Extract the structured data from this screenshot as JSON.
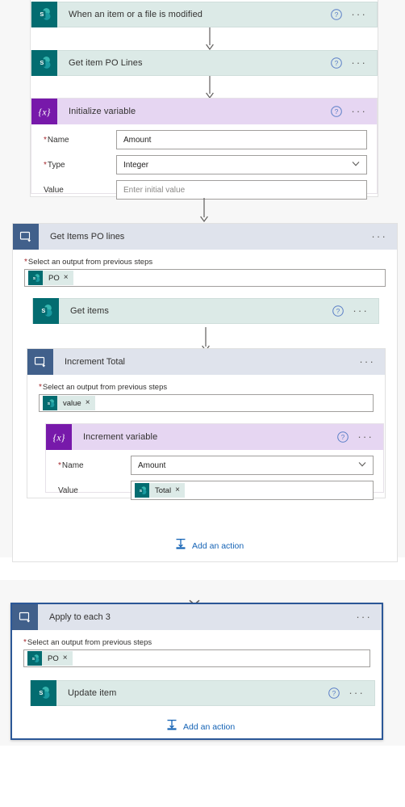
{
  "app": {
    "name": "Power Automate flow designer",
    "connectors": {
      "sharepoint_teal": "#036c70",
      "variable_purple": "#7719aa",
      "scope_blue": "#41608b"
    },
    "link_color": "#1563b5",
    "selected_border": "#2b5797"
  },
  "labels": {
    "add_an_action": "Add an action",
    "select_output": "Select an output from previous steps",
    "required_marker": "*",
    "ellipsis": "···",
    "chip_remove": "×"
  },
  "icons": {
    "sharepoint": "sharepoint-icon",
    "variable": "variable-braces-icon",
    "scope": "foreach-scope-icon",
    "help": "help-circle-icon",
    "more": "more-menu-icon",
    "chevron": "chevron-down-icon",
    "add_action": "add-action-icon"
  },
  "flow": {
    "trigger": {
      "title": "When an item or a file is modified",
      "connector": "SharePoint"
    },
    "get_item_po_lines": {
      "title": "Get item PO Lines",
      "connector": "SharePoint"
    },
    "initialize_variable": {
      "title": "Initialize variable",
      "connector": "Variable",
      "fields": [
        {
          "label": "Name",
          "required": true,
          "type": "text",
          "value": "Amount",
          "placeholder": ""
        },
        {
          "label": "Type",
          "required": true,
          "type": "select",
          "value": "Integer",
          "placeholder": ""
        },
        {
          "label": "Value",
          "required": false,
          "type": "text",
          "value": "",
          "placeholder": "Enter initial value"
        }
      ]
    },
    "scope_get_items_po_lines": {
      "title": "Get Items PO lines",
      "picker_label": "Select an output from previous steps",
      "picker_required": true,
      "token": {
        "label": "PO",
        "icon": "sharepoint-icon"
      },
      "children": {
        "get_items": {
          "title": "Get items",
          "connector": "SharePoint"
        },
        "scope_increment_total": {
          "title": "Increment Total",
          "picker_label": "Select an output from previous steps",
          "picker_required": true,
          "token": {
            "label": "value",
            "icon": "sharepoint-icon"
          },
          "children": {
            "increment_variable": {
              "title": "Increment variable",
              "connector": "Variable",
              "fields": [
                {
                  "label": "Name",
                  "required": true,
                  "type": "select",
                  "value": "Amount"
                },
                {
                  "label": "Value",
                  "required": false,
                  "type": "token",
                  "token": {
                    "label": "Total",
                    "icon": "sharepoint-icon"
                  }
                }
              ]
            }
          }
        }
      },
      "add_action_label": "Add an action"
    },
    "scope_apply_to_each_3": {
      "title": "Apply to each 3",
      "selected": true,
      "picker_label": "Select an output from previous steps",
      "picker_required": true,
      "token": {
        "label": "PO",
        "icon": "sharepoint-icon"
      },
      "children": {
        "update_item": {
          "title": "Update item",
          "connector": "SharePoint"
        }
      },
      "add_action_label": "Add an action"
    }
  }
}
